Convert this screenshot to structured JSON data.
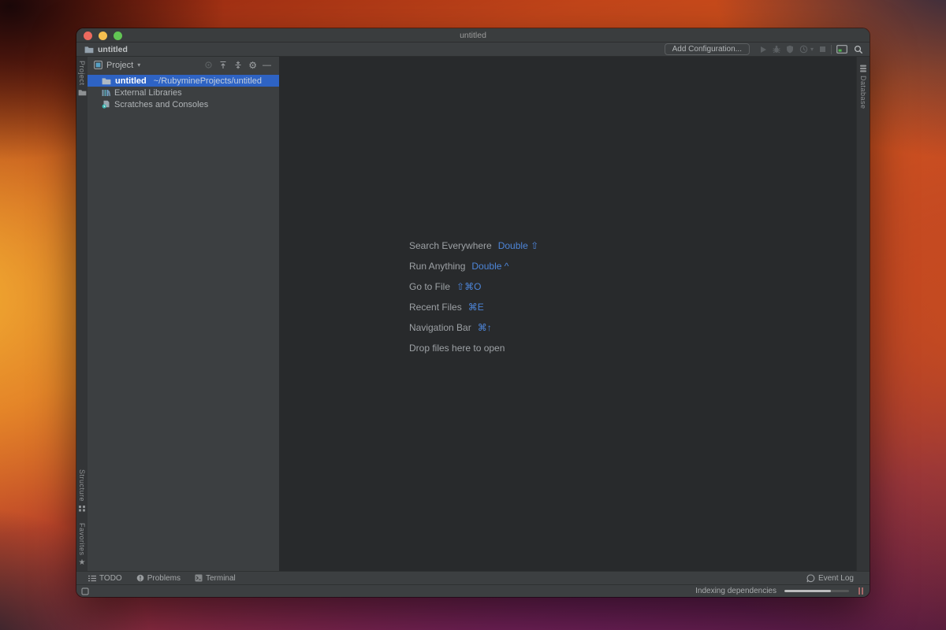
{
  "window": {
    "title": "untitled"
  },
  "toolbar": {
    "breadcrumb": "untitled",
    "breadcrumb_icon": "folder-icon",
    "add_configuration_label": "Add Configuration...",
    "icons": [
      "run-icon",
      "debug-icon",
      "coverage-icon",
      "profiler-icon",
      "dropdown-caret-icon",
      "stop-icon",
      "tool-windows-icon",
      "search-icon"
    ]
  },
  "left_stripe": {
    "top": [
      {
        "label": "Project",
        "icon": "folder-icon"
      }
    ],
    "bottom": [
      {
        "label": "Structure",
        "icon": "structure-icon"
      },
      {
        "label": "Favorites",
        "icon": "star-icon"
      }
    ]
  },
  "right_stripe": {
    "items": [
      {
        "label": "Database",
        "icon": "database-icon"
      }
    ]
  },
  "project_panel": {
    "title": "Project",
    "caret": "▾",
    "header_icons": [
      "locate-icon",
      "expand-all-icon",
      "collapse-all-icon",
      "settings-gear-icon",
      "hide-panel-icon"
    ],
    "gear_glyph": "⚙",
    "minus_glyph": "—",
    "tree": [
      {
        "name": "untitled",
        "path": "~/RubymineProjects/untitled",
        "icon": "folder-icon",
        "selected": true
      },
      {
        "name": "External Libraries",
        "path": "",
        "icon": "libraries-icon",
        "selected": false
      },
      {
        "name": "Scratches and Consoles",
        "path": "",
        "icon": "scratches-icon",
        "selected": false
      }
    ]
  },
  "editor": {
    "shortcuts": [
      {
        "label": "Search Everywhere",
        "keys": "Double ⇧"
      },
      {
        "label": "Run Anything",
        "keys": "Double ^"
      },
      {
        "label": "Go to File",
        "keys": "⇧⌘O"
      },
      {
        "label": "Recent Files",
        "keys": "⌘E"
      },
      {
        "label": "Navigation Bar",
        "keys": "⌘↑"
      },
      {
        "label": "Drop files here to open",
        "keys": ""
      }
    ]
  },
  "bottom_bar": {
    "tabs": [
      {
        "label": "TODO",
        "icon": "todo-list-icon"
      },
      {
        "label": "Problems",
        "icon": "problems-icon"
      },
      {
        "label": "Terminal",
        "icon": "terminal-icon"
      }
    ],
    "event_log_label": "Event Log",
    "event_log_icon": "event-log-balloon-icon"
  },
  "status_bar": {
    "indexing_label": "Indexing dependencies",
    "progress_percent": 72,
    "pause_icon": "pause-icon",
    "tool_switcher_icon": "tool-windows-switcher-icon"
  },
  "colors": {
    "selection_blue": "#2e63c4",
    "link_blue": "#4d85d8",
    "traffic_red": "#ec6a5e",
    "traffic_yellow": "#f5bf4f",
    "traffic_green": "#62c554",
    "accent_green": "#4db54d",
    "panel_bg": "#3c3f41",
    "editor_bg": "#282a2c",
    "stripe_bg": "#333537"
  }
}
